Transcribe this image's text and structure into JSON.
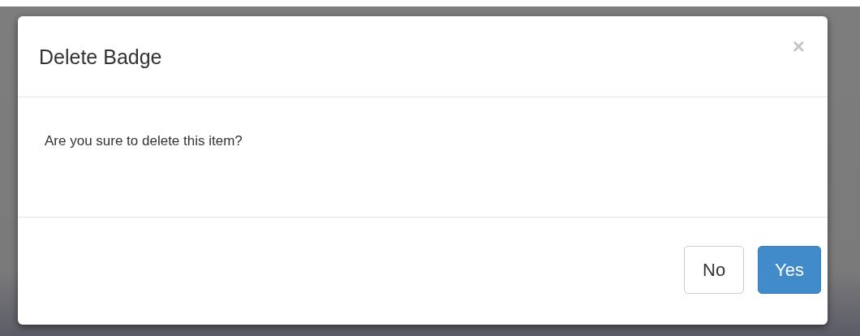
{
  "dialog": {
    "title": "Delete Badge",
    "close": "×",
    "message": "Are you sure to delete this item?",
    "buttons": [
      {
        "label": "No",
        "kind": "default"
      },
      {
        "label": "Yes",
        "kind": "primary"
      }
    ]
  }
}
